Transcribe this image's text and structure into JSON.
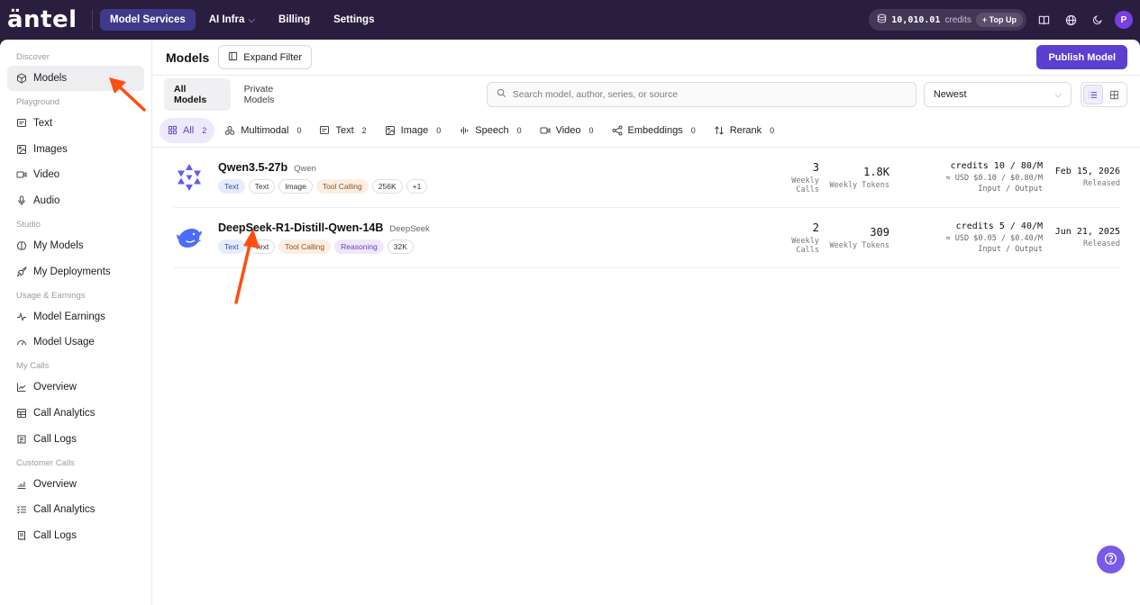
{
  "brand": {
    "logo_text": "äntel"
  },
  "topnav": {
    "items": [
      {
        "label": "Model Services",
        "active": true
      },
      {
        "label": "AI Infra",
        "has_dropdown": true
      },
      {
        "label": "Billing"
      },
      {
        "label": "Settings"
      }
    ],
    "credits_value": "10,010.01",
    "credits_label": "credits",
    "topup_label": "+ Top Up",
    "avatar_letter": "P"
  },
  "sidebar": {
    "sections": [
      {
        "title": "Discover",
        "items": [
          {
            "label": "Models",
            "icon": "cube-icon",
            "active": true
          }
        ]
      },
      {
        "title": "Playground",
        "items": [
          {
            "label": "Text",
            "icon": "message-icon"
          },
          {
            "label": "Images",
            "icon": "image-icon"
          },
          {
            "label": "Video",
            "icon": "video-icon"
          },
          {
            "label": "Audio",
            "icon": "mic-icon"
          }
        ]
      },
      {
        "title": "Studio",
        "items": [
          {
            "label": "My Models",
            "icon": "brain-icon"
          },
          {
            "label": "My Deployments",
            "icon": "rocket-icon"
          }
        ]
      },
      {
        "title": "Usage & Earnings",
        "items": [
          {
            "label": "Model Earnings",
            "icon": "pulse-icon"
          },
          {
            "label": "Model Usage",
            "icon": "gauge-icon"
          }
        ]
      },
      {
        "title": "My Calls",
        "items": [
          {
            "label": "Overview",
            "icon": "trend-icon"
          },
          {
            "label": "Call Analytics",
            "icon": "table-icon"
          },
          {
            "label": "Call Logs",
            "icon": "logs-icon"
          }
        ]
      },
      {
        "title": "Customer Calls",
        "items": [
          {
            "label": "Overview",
            "icon": "chart-icon"
          },
          {
            "label": "Call Analytics",
            "icon": "list-check-icon"
          },
          {
            "label": "Call Logs",
            "icon": "receipt-icon"
          }
        ]
      }
    ]
  },
  "page": {
    "title": "Models",
    "expand_filter_label": "Expand Filter",
    "publish_label": "Publish Model",
    "tabs": [
      {
        "label": "All Models",
        "active": true
      },
      {
        "label": "Private Models"
      }
    ],
    "search_placeholder": "Search model, author, series, or source",
    "sort_value": "Newest",
    "categories": [
      {
        "label": "All",
        "count": "2",
        "icon": "grid-icon",
        "active": true
      },
      {
        "label": "Multimodal",
        "count": "0",
        "icon": "shapes-icon"
      },
      {
        "label": "Text",
        "count": "2",
        "icon": "message-icon"
      },
      {
        "label": "Image",
        "count": "0",
        "icon": "image-icon"
      },
      {
        "label": "Speech",
        "count": "0",
        "icon": "waveform-icon"
      },
      {
        "label": "Video",
        "count": "0",
        "icon": "video-icon"
      },
      {
        "label": "Embeddings",
        "count": "0",
        "icon": "share-icon"
      },
      {
        "label": "Rerank",
        "count": "0",
        "icon": "sort-icon"
      }
    ]
  },
  "models": [
    {
      "name": "Qwen3.5-27b",
      "author": "Qwen",
      "tags": [
        {
          "label": "Text",
          "style": "blue"
        },
        {
          "label": "Text",
          "style": "plain"
        },
        {
          "label": "Image",
          "style": "plain"
        },
        {
          "label": "Tool Calling",
          "style": "orange"
        },
        {
          "label": "256K",
          "style": "plain"
        },
        {
          "label": "+1",
          "style": "plain"
        }
      ],
      "weekly_calls": "3",
      "weekly_calls_label": "Weekly Calls",
      "weekly_tokens": "1.8K",
      "weekly_tokens_label": "Weekly Tokens",
      "price_credits": "credits 10 / 80/M",
      "price_usd": "≈ USD $0.10 / $0.80/M",
      "price_io": "Input / Output",
      "date": "Feb 15, 2026",
      "date_status": "Released",
      "logo_color": "#615ced"
    },
    {
      "name": "DeepSeek-R1-Distill-Qwen-14B",
      "author": "DeepSeek",
      "tags": [
        {
          "label": "Text",
          "style": "blue"
        },
        {
          "label": "Text",
          "style": "plain"
        },
        {
          "label": "Tool Calling",
          "style": "orange"
        },
        {
          "label": "Reasoning",
          "style": "purple"
        },
        {
          "label": "32K",
          "style": "plain"
        }
      ],
      "weekly_calls": "2",
      "weekly_calls_label": "Weekly Calls",
      "weekly_tokens": "309",
      "weekly_tokens_label": "Weekly Tokens",
      "price_credits": "credits 5 / 40/M",
      "price_usd": "≈ USD $0.05 / $0.40/M",
      "price_io": "Input / Output",
      "date": "Jun 21, 2025",
      "date_status": "Released",
      "logo_color": "#4d6bfe"
    }
  ],
  "colors": {
    "accent": "#5b3fd0",
    "annotation_arrow": "#ff4d0f",
    "topbar": "#2a1e3f"
  }
}
